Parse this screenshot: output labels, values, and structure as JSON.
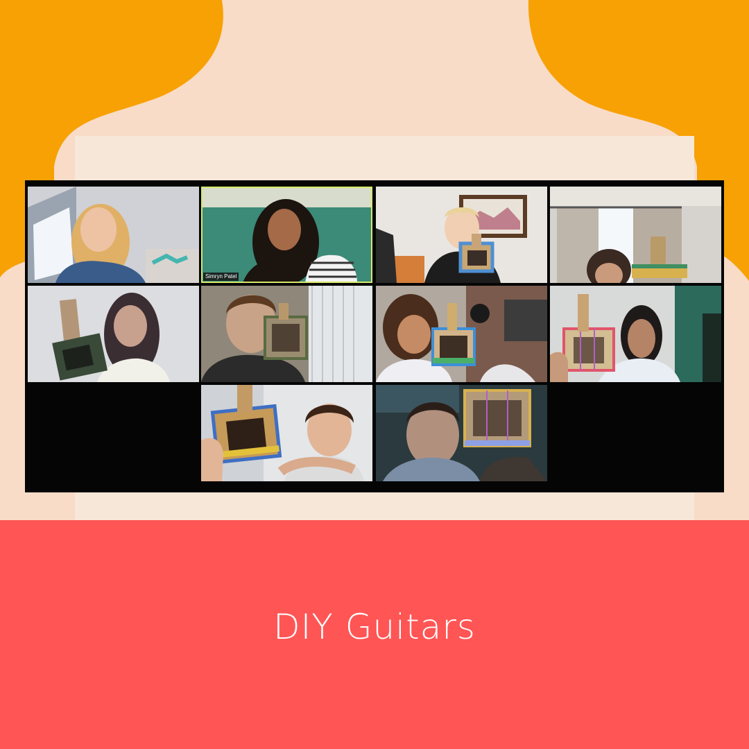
{
  "caption": "DIY Guitars",
  "colors": {
    "orange": "#f8a104",
    "peach": "#f8dcc8",
    "cream": "#f7e7d9",
    "coral": "#ff5555",
    "active_speaker_outline": "#d6e86a"
  },
  "participants": [
    {
      "row": 0,
      "col": 0,
      "label": ""
    },
    {
      "row": 0,
      "col": 1,
      "label": "Simryn Patel",
      "active": true
    },
    {
      "row": 0,
      "col": 2,
      "label": ""
    },
    {
      "row": 0,
      "col": 3,
      "label": ""
    },
    {
      "row": 1,
      "col": 0,
      "label": ""
    },
    {
      "row": 1,
      "col": 1,
      "label": ""
    },
    {
      "row": 1,
      "col": 2,
      "label": ""
    },
    {
      "row": 1,
      "col": 3,
      "label": ""
    },
    {
      "row": 2,
      "col": 1,
      "label": ""
    },
    {
      "row": 2,
      "col": 2,
      "label": ""
    }
  ]
}
